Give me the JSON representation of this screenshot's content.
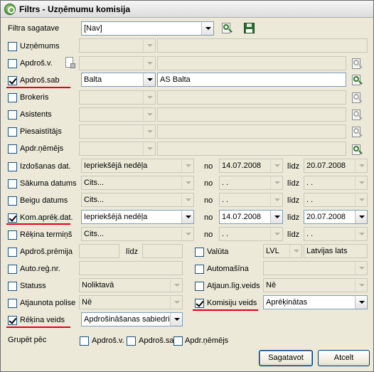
{
  "window": {
    "title": "Filtrs - Uzņēmumu komisija"
  },
  "filter_template": {
    "label": "Filtra sagatave",
    "value": "[Nav]"
  },
  "rows": {
    "uznemums": {
      "label": "Uzņēmums"
    },
    "apdros_v": {
      "label": "Apdroš.v."
    },
    "apdros_sab": {
      "label": "Apdroš.sab",
      "code": "Balta",
      "name": "AS Balta"
    },
    "brokeris": {
      "label": "Brokeris"
    },
    "asistents": {
      "label": "Asistents"
    },
    "piesaistitajs": {
      "label": "Piesaistītājs"
    },
    "apdr_nemejs": {
      "label": "Apdr.ņēmējs"
    }
  },
  "date_rows": {
    "no_label": "no",
    "lidz_label": "līdz",
    "izdosanas": {
      "label": "Izdošanas dat.",
      "period": "Iepriekšējā nedēļa",
      "from": "14.07.2008",
      "to": "20.07.2008"
    },
    "sakuma": {
      "label": "Sākuma datums",
      "period": "Cits...",
      "from": "  .  .",
      "to": "  .  ."
    },
    "beigu": {
      "label": "Beigu datums",
      "period": "Cits...",
      "from": "  .  .",
      "to": "  .  ."
    },
    "kom_aprek": {
      "label": "Kom.aprēķ.dat.",
      "period": "Iepriekšējā nedēļa",
      "from": "14.07.2008",
      "to": "20.07.2008"
    },
    "rekina_termins": {
      "label": "Rēķina termiņš",
      "period": "Cits...",
      "from": "  .  .",
      "to": "  .  ."
    }
  },
  "misc": {
    "apdros_premija": {
      "label": "Apdroš.prēmija",
      "lidz": "līdz"
    },
    "valuta": {
      "label": "Valūta",
      "code": "LVL",
      "name": "Latvijas lats"
    },
    "auto_reg": {
      "label": "Auto.reģ.nr."
    },
    "automasina": {
      "label": "Automašīna"
    },
    "statuss": {
      "label": "Statuss",
      "value": "Noliktavā"
    },
    "atjaun_lig": {
      "label": "Atjaun.līg.veids",
      "value": "Nē"
    },
    "atjaunota_polise": {
      "label": "Atjaunota polise",
      "value": "Nē"
    },
    "komisiju_veids": {
      "label": "Komisiju veids",
      "value": "Aprēķinātas"
    },
    "rekina_veids": {
      "label": "Rēķina veids",
      "value": "Apdrošināšanas sabiedrība"
    }
  },
  "group_by": {
    "label": "Grupēt pēc",
    "options": [
      "Apdroš.v.",
      "Apdroš.sab",
      "Apdr.ņēmējs"
    ]
  },
  "buttons": {
    "prepare": "Sagatavot",
    "cancel": "Atcelt"
  },
  "colors": {
    "highlight_underline": "#e2001a",
    "window_bg": "#ece9d8"
  }
}
